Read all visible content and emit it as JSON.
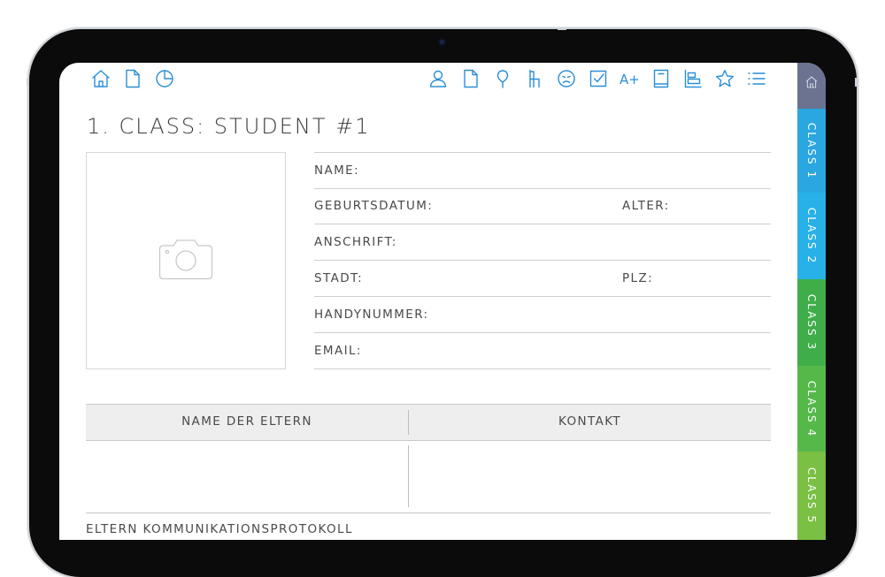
{
  "app": {
    "title": "1. CLASS: STUDENT #1"
  },
  "toolbar": {
    "left_icons": [
      "home-icon",
      "page-icon",
      "pie-chart-icon"
    ],
    "right_icons": [
      "person-icon",
      "page-icon",
      "pin-icon",
      "chair-icon",
      "sad-face-icon",
      "checkbox-icon",
      "grade-icon",
      "book-icon",
      "chart-icon",
      "star-icon",
      "list-icon"
    ],
    "grade_text": "A+",
    "accent_color": "#2a8fd6"
  },
  "student": {
    "photo_icon": "camera-icon",
    "fields": {
      "name": "NAME:",
      "birthdate": "GEBURTSDATUM:",
      "age": "ALTER:",
      "address": "ANSCHRIFT:",
      "city": "STADT:",
      "zip": "PLZ:",
      "phone": "HANDYNUMMER:",
      "email": "EMAIL:"
    }
  },
  "parents_table": {
    "columns": [
      "NAME DER ELTERN",
      "KONTAKT"
    ]
  },
  "communication_log": {
    "title": "ELTERN KOMMUNIKATIONSPROTOKOLL"
  },
  "tabs": [
    {
      "label": "",
      "icon": "home-icon",
      "color": "#6b7391"
    },
    {
      "label": "CLASS 1",
      "color": "#2aa7e0"
    },
    {
      "label": "CLASS 2",
      "color": "#28b1e8"
    },
    {
      "label": "CLASS 3",
      "color": "#3fae49"
    },
    {
      "label": "CLASS 4",
      "color": "#55b94a"
    },
    {
      "label": "CLASS 5",
      "color": "#79c043"
    }
  ]
}
